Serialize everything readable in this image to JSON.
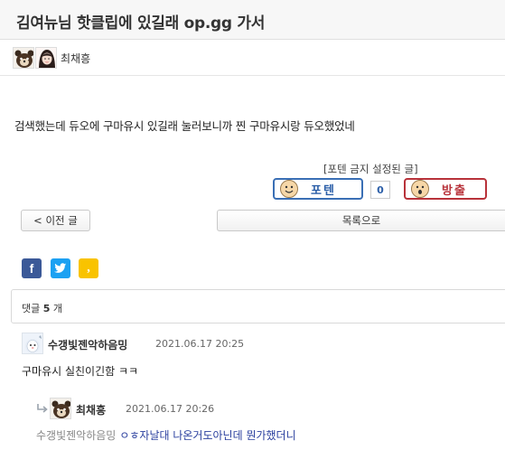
{
  "post": {
    "title": "김여뉴님 핫클립에 있길래 op.gg 가서",
    "author": "최채흥",
    "body": "검색했는데 듀오에 구마유시 있길래 눌러보니까 찐 구마유시랑 듀오했었네"
  },
  "vote": {
    "notice": "[포텐 금지 설정된 글]",
    "up_label": "포텐",
    "count": "0",
    "down_label": "방출"
  },
  "nav": {
    "prev_label": "< 이전 글",
    "list_label": "목록으로"
  },
  "share": {
    "facebook_glyph": "f",
    "kakao_glyph": ","
  },
  "comments_header": {
    "prefix": "댓글 ",
    "count": "5",
    "suffix": " 개"
  },
  "comments": [
    {
      "author": "수갱빛젠악하음밍",
      "date": "2021.06.17 20:25",
      "text": "구마유시 실친이긴함 ㅋㅋ"
    },
    {
      "author": "최채흥",
      "date": "2021.06.17 20:26",
      "mention": "수갱빛젠악하음밍",
      "text": "ㅇㅎ자날대 나온거도아닌데 뭔가했더니"
    }
  ],
  "icons": {
    "avatar_bear": "bear-avatar-icon",
    "avatar_girl": "girl-avatar-icon",
    "avatar_mascot": "mascot-avatar-icon",
    "reply": "reply-arrow-icon"
  },
  "colors": {
    "vote_up": "#3a6fb5",
    "vote_down": "#b8323a",
    "facebook": "#3b5998",
    "twitter": "#1da1f2",
    "kakao": "#f9c300",
    "reply_text": "#2a3f9e"
  }
}
